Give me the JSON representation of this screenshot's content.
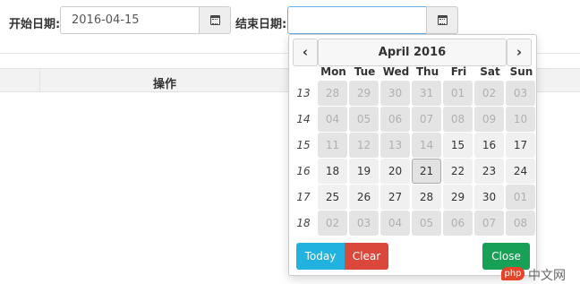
{
  "filter": {
    "start_label": "开始日期:",
    "start_value": "2016-04-15",
    "end_label": "结束日期:",
    "end_value": "",
    "calendar_icon": "calendar-icon"
  },
  "table": {
    "header_ops": "操作"
  },
  "datepicker": {
    "title": "April 2016",
    "prev_icon": "chevron-left-icon",
    "next_icon": "chevron-right-icon",
    "weekdays": [
      "Mon",
      "Tue",
      "Wed",
      "Thu",
      "Fri",
      "Sat",
      "Sun"
    ],
    "selected_day": "21",
    "weeks": [
      {
        "num": "13",
        "days": [
          {
            "d": "28",
            "state": "disabled"
          },
          {
            "d": "29",
            "state": "disabled"
          },
          {
            "d": "30",
            "state": "disabled"
          },
          {
            "d": "31",
            "state": "disabled"
          },
          {
            "d": "01",
            "state": "disabled"
          },
          {
            "d": "02",
            "state": "disabled"
          },
          {
            "d": "03",
            "state": "disabled"
          }
        ]
      },
      {
        "num": "14",
        "days": [
          {
            "d": "04",
            "state": "disabled"
          },
          {
            "d": "05",
            "state": "disabled"
          },
          {
            "d": "06",
            "state": "disabled"
          },
          {
            "d": "07",
            "state": "disabled"
          },
          {
            "d": "08",
            "state": "disabled"
          },
          {
            "d": "09",
            "state": "disabled"
          },
          {
            "d": "10",
            "state": "disabled"
          }
        ]
      },
      {
        "num": "15",
        "days": [
          {
            "d": "11",
            "state": "disabled"
          },
          {
            "d": "12",
            "state": "disabled"
          },
          {
            "d": "13",
            "state": "disabled"
          },
          {
            "d": "14",
            "state": "disabled"
          },
          {
            "d": "15",
            "state": "enabled"
          },
          {
            "d": "16",
            "state": "enabled"
          },
          {
            "d": "17",
            "state": "enabled"
          }
        ]
      },
      {
        "num": "16",
        "days": [
          {
            "d": "18",
            "state": "enabled"
          },
          {
            "d": "19",
            "state": "enabled"
          },
          {
            "d": "20",
            "state": "enabled"
          },
          {
            "d": "21",
            "state": "today"
          },
          {
            "d": "22",
            "state": "enabled"
          },
          {
            "d": "23",
            "state": "enabled"
          },
          {
            "d": "24",
            "state": "enabled"
          }
        ]
      },
      {
        "num": "17",
        "days": [
          {
            "d": "25",
            "state": "enabled"
          },
          {
            "d": "26",
            "state": "enabled"
          },
          {
            "d": "27",
            "state": "enabled"
          },
          {
            "d": "28",
            "state": "enabled"
          },
          {
            "d": "29",
            "state": "enabled"
          },
          {
            "d": "30",
            "state": "enabled"
          },
          {
            "d": "01",
            "state": "disabled"
          }
        ]
      },
      {
        "num": "18",
        "days": [
          {
            "d": "02",
            "state": "disabled"
          },
          {
            "d": "03",
            "state": "disabled"
          },
          {
            "d": "04",
            "state": "disabled"
          },
          {
            "d": "05",
            "state": "disabled"
          },
          {
            "d": "06",
            "state": "disabled"
          },
          {
            "d": "07",
            "state": "disabled"
          },
          {
            "d": "08",
            "state": "disabled"
          }
        ]
      }
    ],
    "buttons": {
      "today": "Today",
      "clear": "Clear",
      "close": "Close"
    }
  },
  "colors": {
    "today_button": "#22b2e0",
    "clear_button": "#d9483b",
    "close_button": "#17a156",
    "disabled_day_bg": "#e4e4e4",
    "enabled_day_bg": "#f0f0f0"
  },
  "watermark": {
    "icon_text": "php",
    "text": "中文网"
  }
}
